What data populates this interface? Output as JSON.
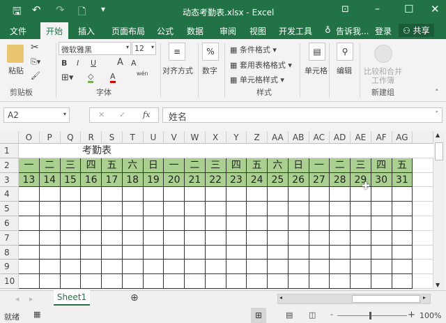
{
  "window": {
    "title": "动态考勤表.xlsx - Excel"
  },
  "tabs": [
    "文件",
    "开始",
    "插入",
    "页面布局",
    "公式",
    "数据",
    "审阅",
    "视图",
    "开发工具"
  ],
  "tell_me": "告诉我...",
  "login": "登录",
  "share": "共享",
  "ribbon": {
    "paste": "粘贴",
    "clipboard": "剪贴板",
    "font_name": "微软雅黑",
    "font_size": "12",
    "bold": "B",
    "italic": "I",
    "underline": "U",
    "font_group": "字体",
    "align": "对齐方式",
    "number": "数字",
    "percent": "%",
    "cond_format": "条件格式",
    "table_format": "套用表格格式",
    "cell_style": "单元格样式",
    "styles_group": "样式",
    "cells": "单元格",
    "edit": "编辑",
    "compare": "比较和合并",
    "workbook": "工作簿",
    "new_group": "新建组",
    "pinyin": "wén"
  },
  "formula_bar": {
    "name_box": "A2",
    "formula": "姓名",
    "fx": "fx"
  },
  "columns": [
    "O",
    "P",
    "Q",
    "R",
    "S",
    "T",
    "U",
    "V",
    "W",
    "X",
    "Y",
    "Z",
    "AA",
    "AB",
    "AC",
    "AD",
    "AE",
    "AF",
    "AG"
  ],
  "rows": [
    "1",
    "2",
    "3",
    "4",
    "5",
    "6",
    "7",
    "8",
    "9",
    "10"
  ],
  "sheet_title": "考勤表",
  "weekdays": [
    "一",
    "二",
    "三",
    "四",
    "五",
    "六",
    "日",
    "一",
    "二",
    "三",
    "四",
    "五",
    "六",
    "日",
    "一",
    "二",
    "三",
    "四",
    "五"
  ],
  "days": [
    "13",
    "14",
    "15",
    "16",
    "17",
    "18",
    "19",
    "20",
    "21",
    "22",
    "23",
    "24",
    "25",
    "26",
    "27",
    "28",
    "29",
    "30",
    "31"
  ],
  "sheet_tab": "Sheet1",
  "status": {
    "ready": "就绪",
    "zoom": "100%"
  },
  "colors": {
    "brand": "#217346",
    "fill": "#a9d08e"
  }
}
